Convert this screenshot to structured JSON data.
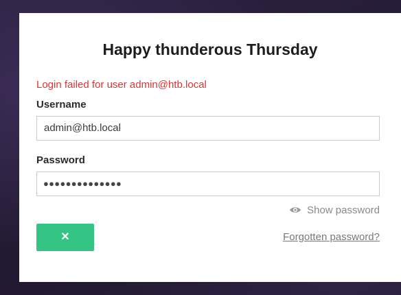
{
  "form": {
    "title": "Happy thunderous Thursday",
    "error_message": "Login failed for user admin@htb.local",
    "username_label": "Username",
    "username_value": "admin@htb.local",
    "password_label": "Password",
    "password_masked": "●●●●●●●●●●●●●●",
    "show_password_label": "Show password",
    "submit_icon": "close-icon",
    "submit_glyph": "✕",
    "forgot_link": "Forgotten password?"
  },
  "colors": {
    "error": "#e0332f",
    "submit_button": "#34c585",
    "background": "#2a1f3a"
  }
}
